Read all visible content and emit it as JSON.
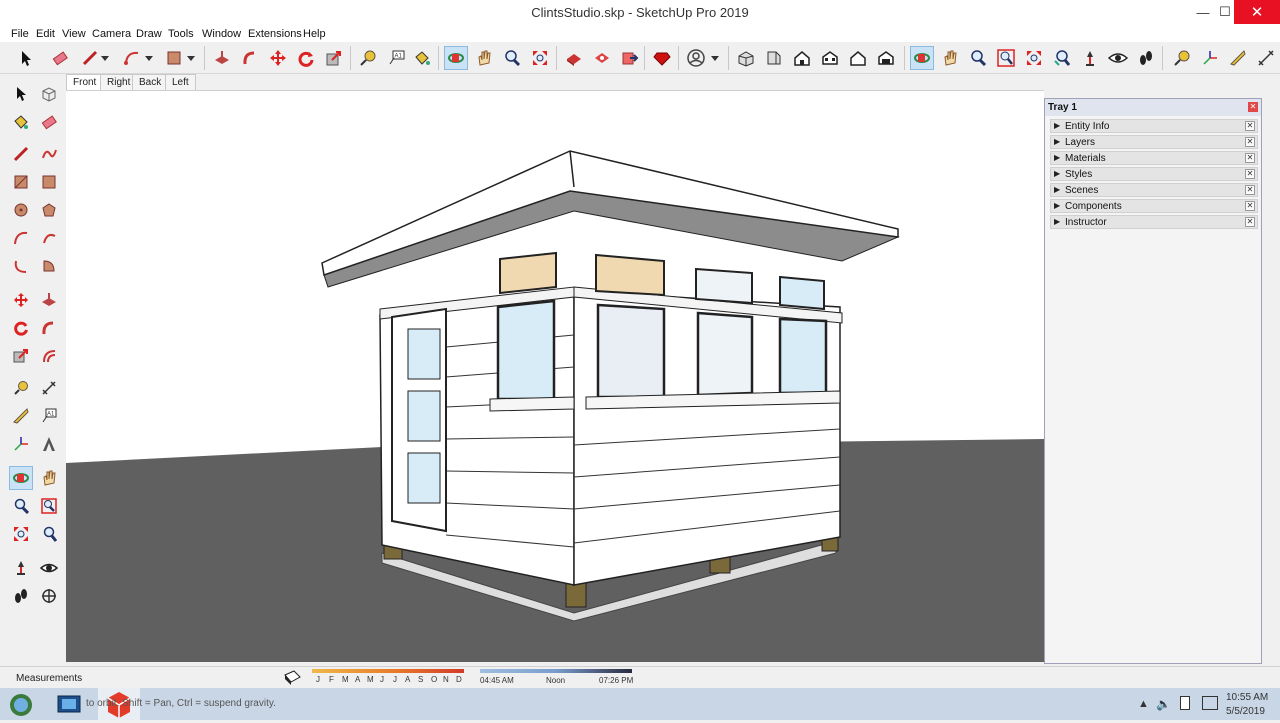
{
  "window": {
    "title": "ClintsStudio.skp - SketchUp Pro 2019",
    "minimize": "—",
    "maximize": "☐",
    "close": "✕"
  },
  "menu": [
    "File",
    "Edit",
    "View",
    "Camera",
    "Draw",
    "Tools",
    "Window",
    "Extensions",
    "Help"
  ],
  "scene_tabs": [
    "Front",
    "Right",
    "Back",
    "Left"
  ],
  "active_scene": "Front",
  "tray": {
    "title": "Tray 1",
    "panels": [
      "Entity Info",
      "Layers",
      "Materials",
      "Styles",
      "Scenes",
      "Components",
      "Instructor"
    ]
  },
  "status": {
    "measurements_label": "Measurements",
    "hint": "to orbit. Shift = Pan, Ctrl = suspend gravity.",
    "months": [
      "J",
      "F",
      "M",
      "A",
      "M",
      "J",
      "J",
      "A",
      "S",
      "O",
      "N",
      "D"
    ],
    "time_start": "04:45 AM",
    "time_noon": "Noon",
    "time_end": "07:26 PM"
  },
  "clock": {
    "time": "10:55 AM",
    "date": "5/5/2019"
  },
  "colors": {
    "ground": "#606060",
    "sky": "#ffffff",
    "active_tool": "#c9e2f5",
    "close_red": "#e81123"
  }
}
